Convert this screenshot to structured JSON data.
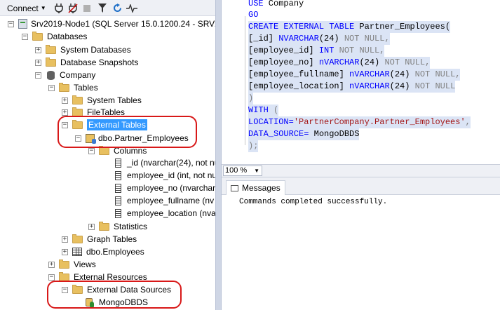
{
  "toolbar": {
    "connect_label": "Connect",
    "icons": [
      "connect-plug-icon",
      "disconnect-icon",
      "stop-icon",
      "filter-icon",
      "refresh-icon",
      "activity-monitor-icon"
    ]
  },
  "tree": {
    "server": "Srv2019-Node1 (SQL Server 15.0.1200.24 - SRV201",
    "databases": "Databases",
    "system_databases": "System Databases",
    "database_snapshots": "Database Snapshots",
    "company": "Company",
    "tables": "Tables",
    "system_tables": "System Tables",
    "file_tables": "FileTables",
    "external_tables": "External Tables",
    "partner_employees": "dbo.Partner_Employees",
    "columns": "Columns",
    "column_items": [
      "_id (nvarchar(24), not nu",
      "employee_id (int, not nu",
      "employee_no (nvarchar",
      "employee_fullname (nv",
      "employee_location (nva"
    ],
    "statistics": "Statistics",
    "graph_tables": "Graph Tables",
    "dbo_employees": "dbo.Employees",
    "views": "Views",
    "external_resources": "External Resources",
    "external_data_sources": "External Data Sources",
    "mongodbds": "MongoDBDS"
  },
  "editor": {
    "l1_kw": "USE",
    "l1_rest": " Company",
    "l2_kw": "GO",
    "l3_kw": "CREATE EXTERNAL TABLE",
    "l3_rest": " Partner_Employees(",
    "l4_a": "[_id] ",
    "l4_b": "NVARCHAR",
    "l4_c": "(24) ",
    "l4_d": "NOT NULL,",
    "l5_a": "[employee_id] ",
    "l5_b": "INT",
    "l5_c": " ",
    "l5_d": "NOT NULL,",
    "l6_a": "[employee_no] ",
    "l6_b": "nVARCHAR",
    "l6_c": "(24) ",
    "l6_d": "NOT NULL,",
    "l7_a": "[employee_fullname] ",
    "l7_b": "nVARCHAR",
    "l7_c": "(24) ",
    "l7_d": "NOT NULL,",
    "l8_a": "[employee_location] ",
    "l8_b": "nVARCHAR",
    "l8_c": "(24) ",
    "l8_d": "NOT NULL",
    "l9": ")",
    "l10_kw": "WITH",
    "l10_rest": " (",
    "l11_a": "LOCATION=",
    "l11_b": "'PartnerCompany.Partner_Employees'",
    "l11_c": ",",
    "l12_a": "DATA_SOURCE=",
    "l12_b": " MongoDBDS",
    "l13": ");"
  },
  "zoom": "100 %",
  "messages_tab": "Messages",
  "message_text": "Commands completed successfully."
}
